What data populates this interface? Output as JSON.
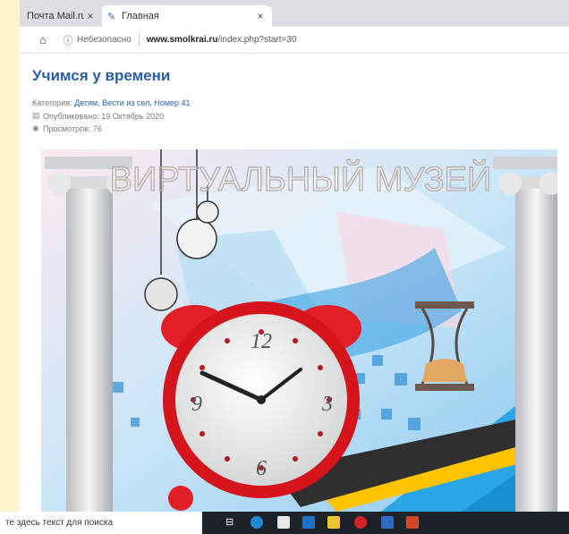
{
  "tabs": [
    {
      "label": "Почта Mail.ru",
      "active": false
    },
    {
      "label": "Главная",
      "active": true
    }
  ],
  "address": {
    "insecure": "Небезопасно",
    "domain": "www.smolkrai.ru",
    "path": "/index.php?start=30"
  },
  "article": {
    "title": "Учимся у времени",
    "category_label": "Категория:",
    "category_value": "Детям, Вести из сел, Номер 41",
    "published": "Опубликовано: 19 Октябрь 2020",
    "views": "Просмотров: 76"
  },
  "picture": {
    "banner": "ВИРТУАЛЬНЫЙ МУЗЕЙ",
    "clock_numbers": [
      "12",
      "3",
      "6",
      "9"
    ]
  },
  "taskbar": {
    "search_placeholder": "те здесь текст для поиска",
    "apps": [
      "task-view",
      "edge",
      "store",
      "mail",
      "explorer",
      "opera",
      "media",
      "powerpoint"
    ]
  },
  "colors": {
    "title": "#2b5ea8",
    "page_background": "#fdf6cf",
    "taskbar": "#1d2329"
  }
}
